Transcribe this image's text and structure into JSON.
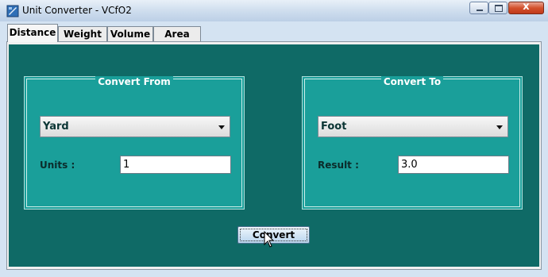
{
  "window": {
    "title": "Unit Converter - VCfO2",
    "close_glyph": "x"
  },
  "tabs": [
    {
      "label": "Distance",
      "active": true
    },
    {
      "label": "Weight",
      "active": false
    },
    {
      "label": "Volume",
      "active": false
    },
    {
      "label": "Area",
      "active": false
    }
  ],
  "convert_from": {
    "title": "Convert From",
    "unit": "Yard",
    "field_label": "Units :",
    "value": "1"
  },
  "convert_to": {
    "title": "Convert To",
    "unit": "Foot",
    "field_label": "Result :",
    "value": "3.0"
  },
  "convert_button": {
    "label": "Convert"
  },
  "colors": {
    "panel": "#0f6a66",
    "group": "#1a9f9a"
  },
  "icons": [
    "app-icon",
    "minimize-icon",
    "maximize-icon",
    "close-icon",
    "dropdown-arrow-icon",
    "mouse-pointer-icon"
  ]
}
